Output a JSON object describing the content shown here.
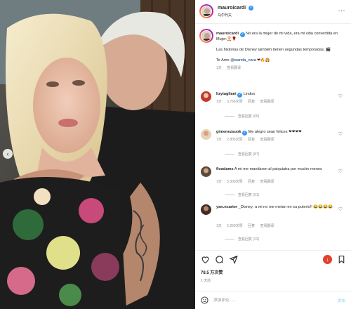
{
  "post": {
    "username": "mauroicardi",
    "subtitle": "马尔代夫",
    "more_icon": "more-horizontal-icon"
  },
  "caption": {
    "username": "mauroicardi",
    "line1": "No era la mujer de mi vida, era mi vida convertida en Mujer.🤶🌹",
    "line2": "Las historias de Disney también tienen segundas temporadas. 🎬",
    "line3_prefix": "Te Amo ",
    "mention": "@wanda_nara",
    "line3_suffix": " ❤🔥👸",
    "time": "1天",
    "translate": "查看翻译"
  },
  "comments": [
    {
      "username": "lizytagliani",
      "text": "Lindos",
      "time": "1天",
      "likes": "3,766次赞",
      "reply": "回复",
      "translate": "查看翻译",
      "replies": "查看回复 (65)"
    },
    {
      "username": "gimenezsuok",
      "text": "Me alegro sean felices ❤❤❤❤",
      "time": "1天",
      "likes": "2,805次赞",
      "reply": "回复",
      "translate": "查看翻译",
      "replies": "查看回复 (87)"
    },
    {
      "username": "fioadams",
      "text": "A mi me mandaron al psiquiatra por mucho menos",
      "time": "1天",
      "likes": "3,300次赞",
      "reply": "回复",
      "translate": "查看翻译",
      "replies": "查看回复 (51)"
    },
    {
      "username": "yan.ncarter",
      "text": "_Disney: a mi no me metan en su puterio!! 😂😂😂😂",
      "time": "1天",
      "likes": "2,269次赞",
      "reply": "回复",
      "translate": "查看翻译",
      "replies": "查看回复 (22)"
    }
  ],
  "stats": {
    "likes": "78.5 万次赞",
    "date": "1 天前"
  },
  "composer": {
    "placeholder": "添加评论......",
    "post_label": "发布"
  },
  "colors": {
    "accent": "#0095f6",
    "like_red": "#ed4956",
    "verified": "#3897f0"
  }
}
